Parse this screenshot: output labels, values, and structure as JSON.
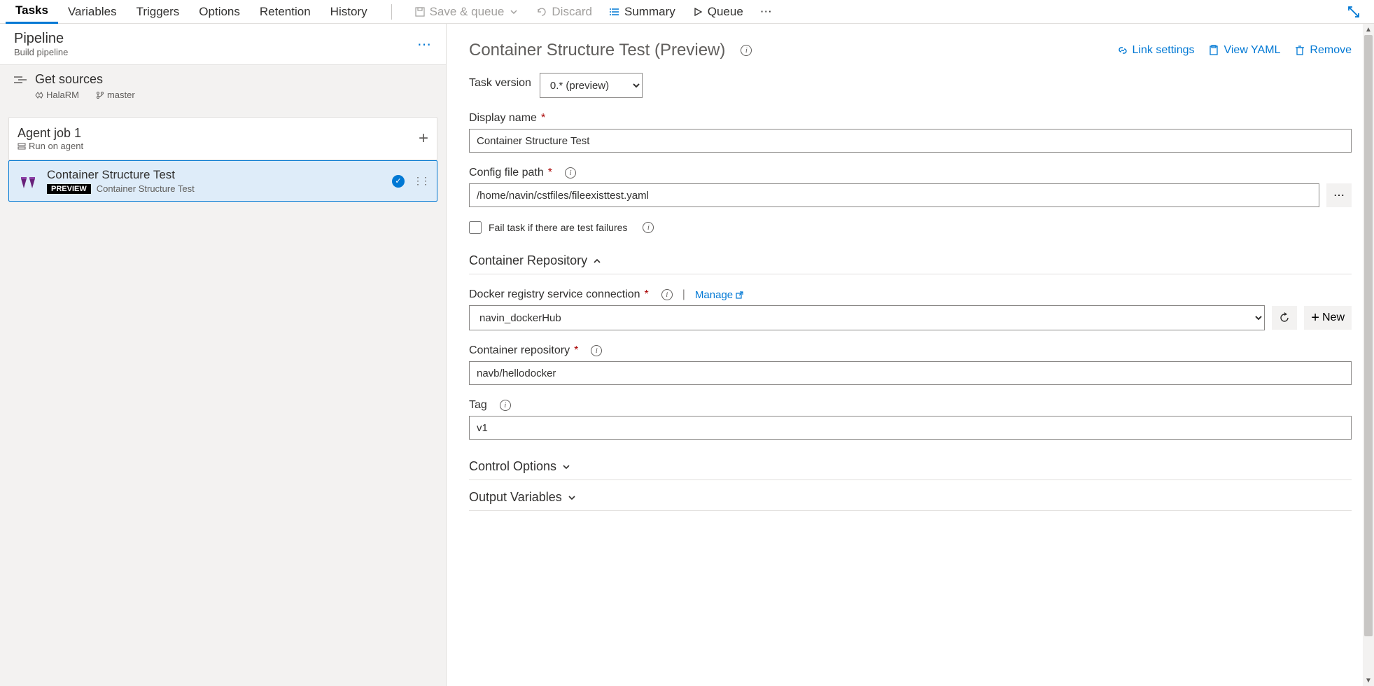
{
  "tabs": [
    "Tasks",
    "Variables",
    "Triggers",
    "Options",
    "Retention",
    "History"
  ],
  "active_tab": "Tasks",
  "toolbar": {
    "save_queue": "Save & queue",
    "discard": "Discard",
    "summary": "Summary",
    "queue": "Queue",
    "more": "⋯"
  },
  "pipeline": {
    "title": "Pipeline",
    "subtitle": "Build pipeline"
  },
  "get_sources": {
    "title": "Get sources",
    "repo": "HalaRM",
    "branch": "master"
  },
  "agent_job": {
    "title": "Agent job 1",
    "subtitle": "Run on agent"
  },
  "task": {
    "name": "Container Structure Test",
    "badge": "PREVIEW",
    "sub": "Container Structure Test"
  },
  "detail": {
    "title": "Container Structure Test (Preview)",
    "link_settings": "Link settings",
    "view_yaml": "View YAML",
    "remove": "Remove",
    "task_version_label": "Task version",
    "task_version_value": "0.* (preview)",
    "display_name_label": "Display name",
    "display_name_value": "Container Structure Test",
    "config_path_label": "Config file path",
    "config_path_value": "/home/navin/cstfiles/fileexisttest.yaml",
    "fail_label": "Fail task if there are test failures",
    "container_repo_section": "Container Repository",
    "docker_conn_label": "Docker registry service connection",
    "manage": "Manage",
    "docker_conn_value": "navin_dockerHub",
    "new_label": "New",
    "container_repo_label": "Container repository",
    "container_repo_value": "navb/hellodocker",
    "tag_label": "Tag",
    "tag_value": "v1",
    "control_options": "Control Options",
    "output_variables": "Output Variables"
  }
}
